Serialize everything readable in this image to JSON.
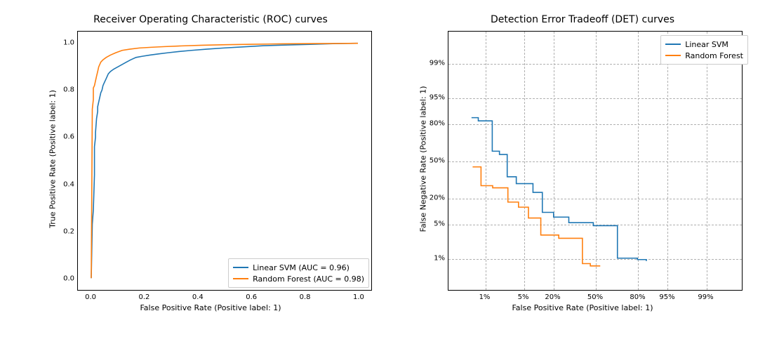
{
  "colors": {
    "svm": "#1f77b4",
    "rf": "#ff7f0e"
  },
  "chart_data": [
    {
      "id": "roc",
      "type": "line",
      "title": "Receiver Operating Characteristic (ROC) curves",
      "xlabel": "False Positive Rate (Positive label: 1)",
      "ylabel": "True Positive Rate (Positive label: 1)",
      "xlim": [
        -0.05,
        1.05
      ],
      "ylim": [
        -0.05,
        1.05
      ],
      "xticks": {
        "pos": [
          0.0,
          0.2,
          0.4,
          0.6,
          0.8,
          1.0
        ],
        "labels": [
          "0.0",
          "0.2",
          "0.4",
          "0.6",
          "0.8",
          "1.0"
        ]
      },
      "yticks": {
        "pos": [
          0.0,
          0.2,
          0.4,
          0.6,
          0.8,
          1.0
        ],
        "labels": [
          "0.0",
          "0.2",
          "0.4",
          "0.6",
          "0.8",
          "1.0"
        ]
      },
      "grid": false,
      "legend_loc": "lower right",
      "legend_box": true,
      "series": [
        {
          "name": "Linear SVM (AUC = 0.96)",
          "color_key": "svm",
          "x": [
            0.0,
            0.004,
            0.008,
            0.012,
            0.012,
            0.016,
            0.016,
            0.02,
            0.024,
            0.024,
            0.028,
            0.032,
            0.036,
            0.04,
            0.044,
            0.048,
            0.056,
            0.064,
            0.072,
            0.084,
            0.1,
            0.116,
            0.132,
            0.148,
            0.168,
            0.192,
            0.22,
            0.252,
            0.288,
            0.328,
            0.376,
            0.432,
            0.496,
            0.568,
            0.648,
            0.736,
            0.832,
            0.916,
            1.0
          ],
          "y": [
            0.0,
            0.23,
            0.29,
            0.44,
            0.56,
            0.6,
            0.62,
            0.68,
            0.71,
            0.73,
            0.75,
            0.77,
            0.79,
            0.8,
            0.82,
            0.83,
            0.85,
            0.87,
            0.88,
            0.89,
            0.9,
            0.91,
            0.92,
            0.93,
            0.94,
            0.945,
            0.95,
            0.955,
            0.96,
            0.965,
            0.97,
            0.975,
            0.98,
            0.985,
            0.99,
            0.993,
            0.996,
            0.999,
            1.0
          ]
        },
        {
          "name": "Random Forest (AUC = 0.98)",
          "color_key": "rf",
          "x": [
            0.0,
            0.004,
            0.008,
            0.008,
            0.012,
            0.016,
            0.02,
            0.024,
            0.028,
            0.036,
            0.044,
            0.056,
            0.072,
            0.092,
            0.116,
            0.144,
            0.18,
            0.224,
            0.276,
            0.34,
            0.416,
            0.504,
            0.604,
            0.716,
            0.836,
            0.924,
            1.0
          ],
          "y": [
            0.0,
            0.72,
            0.76,
            0.81,
            0.82,
            0.84,
            0.86,
            0.88,
            0.9,
            0.92,
            0.93,
            0.94,
            0.95,
            0.96,
            0.97,
            0.975,
            0.98,
            0.983,
            0.986,
            0.989,
            0.992,
            0.994,
            0.996,
            0.998,
            0.999,
            0.9995,
            1.0
          ]
        }
      ]
    },
    {
      "id": "det",
      "type": "line",
      "title": "Detection Error Tradeoff (DET) curves",
      "xlabel": "False Positive Rate (Positive label: 1)",
      "ylabel": "False Negative Rate (Positive label: 1)",
      "scale": "normal-deviate",
      "xlim_frac": [
        0.0,
        1.0
      ],
      "ylim_frac": [
        0.0,
        1.0
      ],
      "tick_fracs": [
        0.125,
        0.256,
        0.356,
        0.5,
        0.644,
        0.744,
        0.875
      ],
      "tick_labels": [
        "1%",
        "5%",
        "20%",
        "50%",
        "80%",
        "95%",
        "99%"
      ],
      "ytick_fracs": [
        0.875,
        0.744,
        0.644,
        0.5,
        0.356,
        0.256,
        0.125
      ],
      "ytick_labels": [
        "1%",
        "5%",
        "20%",
        "50%",
        "80%",
        "95%",
        "99%"
      ],
      "grid": true,
      "legend_loc": "upper right",
      "legend_box": true,
      "series": [
        {
          "name": "Linear SVM",
          "color_key": "svm",
          "fx": [
            0.0785,
            0.1017,
            0.1017,
            0.1492,
            0.1492,
            0.1738,
            0.1738,
            0.2003,
            0.2003,
            0.2312,
            0.2312,
            0.2882,
            0.2882,
            0.3201,
            0.3201,
            0.3584,
            0.3584,
            0.4102,
            0.4102,
            0.4938,
            0.4938,
            0.576,
            0.576,
            0.644,
            0.644,
            0.6745,
            0.6745
          ],
          "fy": [
            0.3332,
            0.3332,
            0.3458,
            0.3458,
            0.4631,
            0.4631,
            0.4757,
            0.4757,
            0.562,
            0.562,
            0.5883,
            0.5883,
            0.6224,
            0.6224,
            0.6998,
            0.6998,
            0.7181,
            0.7181,
            0.7396,
            0.7396,
            0.751,
            0.751,
            0.877,
            0.877,
            0.8824,
            0.8824,
            0.888
          ]
        },
        {
          "name": "Random Forest",
          "color_key": "rf",
          "fx": [
            0.0824,
            0.111,
            0.111,
            0.1508,
            0.1508,
            0.2027,
            0.2027,
            0.2389,
            0.2389,
            0.2726,
            0.2726,
            0.3147,
            0.3147,
            0.376,
            0.376,
            0.4566,
            0.4566,
            0.4835,
            0.4835,
            0.5175,
            0.5175
          ],
          "fy": [
            0.5237,
            0.5237,
            0.5966,
            0.5966,
            0.605,
            0.605,
            0.6599,
            0.6599,
            0.6797,
            0.6797,
            0.7215,
            0.7215,
            0.7875,
            0.7875,
            0.8001,
            0.8001,
            0.898,
            0.898,
            0.9069,
            0.9069,
            0.9069
          ]
        }
      ]
    }
  ]
}
